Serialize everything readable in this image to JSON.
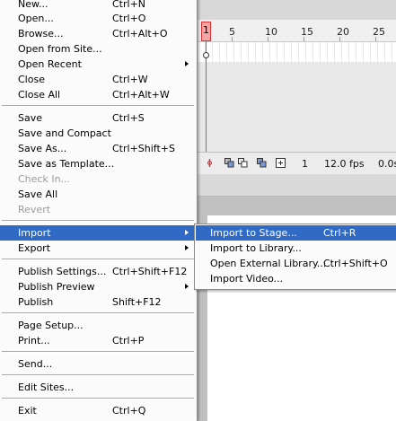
{
  "timeline": {
    "ruler_numbers": [
      "1",
      "5",
      "10",
      "15",
      "20",
      "25"
    ],
    "status": {
      "current_frame": "1",
      "frame_rate": "12.0 fps",
      "elapsed_time": "0.0s"
    }
  },
  "file_menu": {
    "items": [
      {
        "label": "New...",
        "shortcut": "Ctrl+N"
      },
      {
        "label": "Open...",
        "shortcut": "Ctrl+O"
      },
      {
        "label": "Browse...",
        "shortcut": "Ctrl+Alt+O"
      },
      {
        "label": "Open from Site...",
        "shortcut": ""
      },
      {
        "label": "Open Recent",
        "shortcut": ""
      },
      {
        "label": "Close",
        "shortcut": "Ctrl+W"
      },
      {
        "label": "Close All",
        "shortcut": "Ctrl+Alt+W"
      },
      {
        "label": "Save",
        "shortcut": "Ctrl+S"
      },
      {
        "label": "Save and Compact",
        "shortcut": ""
      },
      {
        "label": "Save As...",
        "shortcut": "Ctrl+Shift+S"
      },
      {
        "label": "Save as Template...",
        "shortcut": ""
      },
      {
        "label": "Check In...",
        "shortcut": ""
      },
      {
        "label": "Save All",
        "shortcut": ""
      },
      {
        "label": "Revert",
        "shortcut": ""
      },
      {
        "label": "Import",
        "shortcut": ""
      },
      {
        "label": "Export",
        "shortcut": ""
      },
      {
        "label": "Publish Settings...",
        "shortcut": "Ctrl+Shift+F12"
      },
      {
        "label": "Publish Preview",
        "shortcut": ""
      },
      {
        "label": "Publish",
        "shortcut": "Shift+F12"
      },
      {
        "label": "Page Setup...",
        "shortcut": ""
      },
      {
        "label": "Print...",
        "shortcut": "Ctrl+P"
      },
      {
        "label": "Send...",
        "shortcut": ""
      },
      {
        "label": "Edit Sites...",
        "shortcut": ""
      },
      {
        "label": "Exit",
        "shortcut": "Ctrl+Q"
      }
    ]
  },
  "import_submenu": {
    "items": [
      {
        "label": "Import to Stage...",
        "shortcut": "Ctrl+R"
      },
      {
        "label": "Import to Library...",
        "shortcut": ""
      },
      {
        "label": "Open External Library...",
        "shortcut": "Ctrl+Shift+O"
      },
      {
        "label": "Import Video...",
        "shortcut": ""
      }
    ]
  },
  "colors": {
    "highlight": "#316ac5",
    "playhead": "#e34848",
    "disabled_text": "#9a9a9a"
  }
}
